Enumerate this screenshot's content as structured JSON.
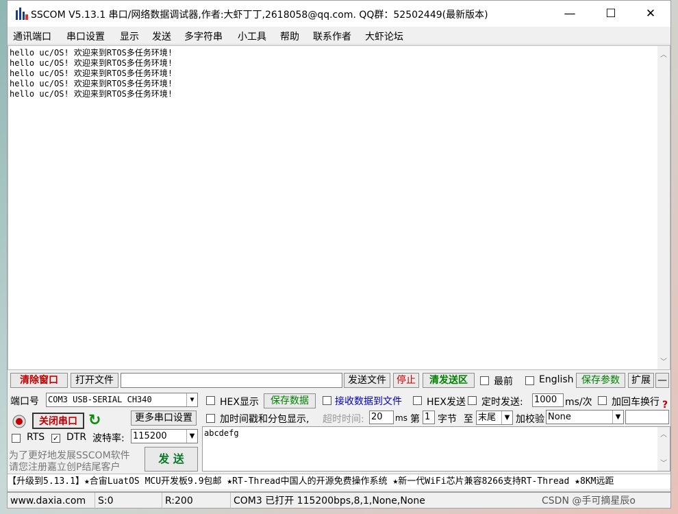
{
  "window": {
    "title": "SSCOM V5.13.1 串口/网络数据调试器,作者:大虾丁丁,2618058@qq.com. QQ群：52502449(最新版本)",
    "minimize": "—",
    "maximize": "☐",
    "close": "✕"
  },
  "menu": [
    "通讯端口",
    "串口设置",
    "显示",
    "发送",
    "多字符串",
    "小工具",
    "帮助",
    "联系作者",
    "大虾论坛"
  ],
  "receive": {
    "lines": [
      "hello uc/OS! 欢迎来到RTOS多任务环境!",
      "hello uc/OS! 欢迎来到RTOS多任务环境!",
      "hello uc/OS! 欢迎来到RTOS多任务环境!",
      "hello uc/OS! 欢迎来到RTOS多任务环境!",
      "hello uc/OS! 欢迎来到RTOS多任务环境!"
    ]
  },
  "toolbar": {
    "clear_window": "清除窗口",
    "open_file": "打开文件",
    "file_path": "",
    "send_file": "发送文件",
    "stop": "停止",
    "clear_send": "清发送区",
    "topmost": "最前",
    "english": "English",
    "save_params": "保存参数",
    "expand": "扩展",
    "collapse": "—"
  },
  "port": {
    "label": "端口号",
    "value": "COM3 USB-SERIAL CH340",
    "close_port": "关闭串口",
    "more_settings": "更多串口设置",
    "rts": "RTS",
    "dtr": "DTR",
    "baud_label": "波特率:",
    "baud_value": "115200"
  },
  "options": {
    "hex_display": "HEX显示",
    "save_data": "保存数据",
    "recv_to_file": "接收数据到文件",
    "hex_send": "HEX发送",
    "timed_send": "定时发送:",
    "interval": "1000",
    "interval_unit": "ms/次",
    "add_crlf": "加回车换行",
    "timestamp": "加时间戳和分包显示,",
    "timeout_label": "超时时间:",
    "timeout_value": "20",
    "timeout_unit": "ms",
    "nth": "第",
    "byte_index": "1",
    "byte_unit": "字节",
    "to": "至",
    "end_value": "末尾",
    "checksum_label": "加校验",
    "checksum_value": "None"
  },
  "send": {
    "text": "abcdefg",
    "button": "发 送"
  },
  "promo": {
    "line1": "为了更好地发展SSCOM软件",
    "line2": "请您注册嘉立创P结尾客户"
  },
  "marquee": "【升级到5.13.1】★合宙LuatOS MCU开发板9.9包邮 ★RT-Thread中国人的开源免费操作系统 ★新一代WiFi芯片兼容8266支持RT-Thread ★8KM远距",
  "status": {
    "site": "www.daxia.com",
    "sent": "S:0",
    "recv": "R:200",
    "port_state": "COM3 已打开  115200bps,8,1,None,None",
    "watermark": "CSDN @手可摘星辰o"
  },
  "colors": {
    "accent_red": "#c00000",
    "accent_green": "#008000",
    "accent_blue": "#0000c0"
  }
}
